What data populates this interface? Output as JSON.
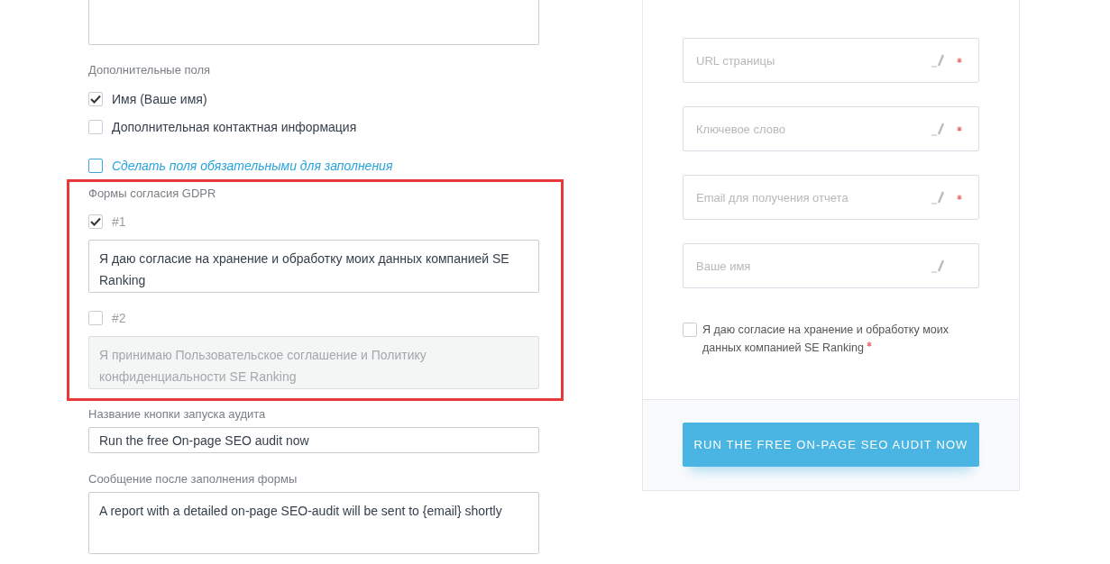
{
  "settings": {
    "additional_fields": {
      "title": "Дополнительные поля",
      "options": [
        {
          "label": "Имя (Ваше имя)",
          "checked": true
        },
        {
          "label": "Дополнительная контактная информация",
          "checked": false
        }
      ]
    },
    "required_toggle": {
      "label": "Сделать поля обязательными для заполнения",
      "checked": false
    },
    "gdpr": {
      "title": "Формы согласия GDPR",
      "highlighted": true,
      "forms": [
        {
          "label": "#1",
          "checked": true,
          "disabled": false,
          "text": "Я даю согласие на хранение и обработку моих данных компанией SE Ranking"
        },
        {
          "label": "#2",
          "checked": false,
          "disabled": true,
          "text": "Я принимаю Пользовательское соглашение и Политику конфиденциальности SE Ranking"
        }
      ]
    },
    "button_name": {
      "label": "Название кнопки запуска аудита",
      "value": "Run the free On-page SEO audit now"
    },
    "message": {
      "label": "Сообщение после заполнения формы",
      "value": "A report with a detailed on-page SEO-audit will be sent to {email} shortly"
    }
  },
  "preview": {
    "fields": [
      {
        "placeholder": "URL страницы",
        "required": true
      },
      {
        "placeholder": "Ключевое слово",
        "required": true
      },
      {
        "placeholder": "Email для получения отчета",
        "required": true
      },
      {
        "placeholder": "Ваше имя",
        "required": false
      }
    ],
    "consent": {
      "text": "Я даю согласие на хранение и обработку моих данных компанией SE Ranking",
      "checked": false,
      "required": true
    },
    "submit": {
      "label": "RUN THE FREE ON-PAGE SEO AUDIT NOW"
    }
  }
}
